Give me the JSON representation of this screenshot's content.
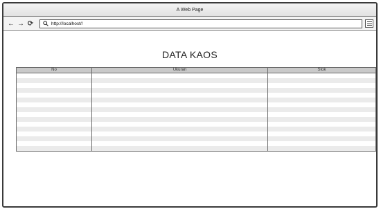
{
  "window": {
    "title": "A Web Page"
  },
  "toolbar": {
    "back_icon": "arrow-left-icon",
    "forward_icon": "arrow-right-icon",
    "reload_icon": "reload-icon",
    "search_icon": "search-icon",
    "url": "http://localhost//",
    "menu_icon": "hamburger-menu-icon"
  },
  "page": {
    "title": "DATA KAOS",
    "table": {
      "columns": [
        "No",
        "Ukuran",
        "Stok"
      ],
      "rows": [
        [
          "",
          "",
          ""
        ],
        [
          "",
          "",
          ""
        ],
        [
          "",
          "",
          ""
        ],
        [
          "",
          "",
          ""
        ],
        [
          "",
          "",
          ""
        ],
        [
          "",
          "",
          ""
        ],
        [
          "",
          "",
          ""
        ],
        [
          "",
          "",
          ""
        ],
        [
          "",
          "",
          ""
        ],
        [
          "",
          "",
          ""
        ],
        [
          "",
          "",
          ""
        ],
        [
          "",
          "",
          ""
        ],
        [
          "",
          "",
          ""
        ],
        [
          "",
          "",
          ""
        ],
        [
          "",
          "",
          ""
        ],
        [
          "",
          "",
          ""
        ]
      ]
    }
  }
}
